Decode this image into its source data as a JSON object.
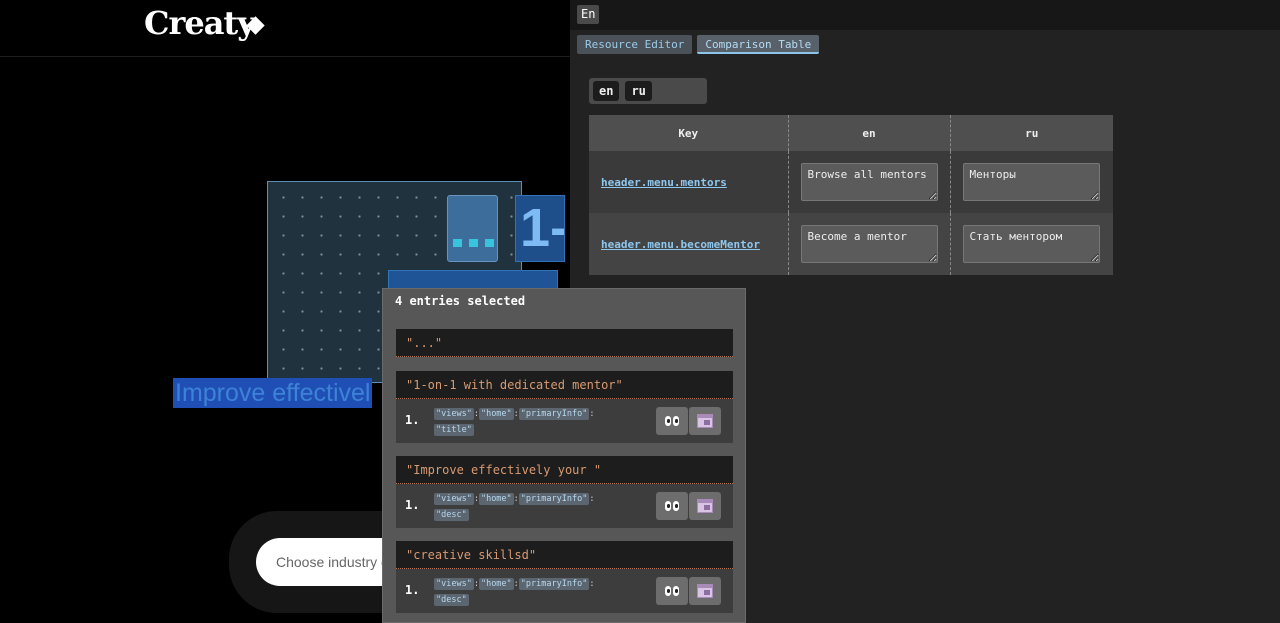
{
  "site": {
    "logo": "Creaty",
    "hero_text": "Improve effectivel",
    "number_tile": "1-",
    "search_placeholder": "Choose industry o"
  },
  "toolbar": {
    "language": "En",
    "tabs": [
      {
        "label": "Resource Editor",
        "active": false
      },
      {
        "label": "Comparison Table",
        "active": true
      }
    ]
  },
  "locales": [
    "en",
    "ru"
  ],
  "table": {
    "headers": [
      "Key",
      "en",
      "ru"
    ],
    "rows": [
      {
        "key": "header.menu.mentors",
        "en": "Browse all mentors",
        "ru": "Менторы"
      },
      {
        "key": "header.menu.becomeMentor",
        "en": "Become a mentor",
        "ru": "Стать ментором"
      }
    ]
  },
  "popup": {
    "title": "4 entries selected",
    "entries": [
      {
        "text": "\"...\""
      },
      {
        "text": "\"1-on-1 with dedicated mentor\"",
        "index": "1.",
        "path": [
          "\"views\"",
          "\"home\"",
          "\"primaryInfo\"",
          "\"title\""
        ]
      },
      {
        "text": "\"Improve effectively your \"",
        "index": "1.",
        "path": [
          "\"views\"",
          "\"home\"",
          "\"primaryInfo\"",
          "\"desc\""
        ]
      },
      {
        "text": "\"creative skillsd\"",
        "index": "1.",
        "path": [
          "\"views\"",
          "\"home\"",
          "\"primaryInfo\"",
          "\"desc\""
        ]
      }
    ],
    "separator": ":"
  },
  "colors": {
    "link": "#8ec8ef",
    "entry_text": "#d89a72",
    "selection": "#1f4fb4"
  }
}
